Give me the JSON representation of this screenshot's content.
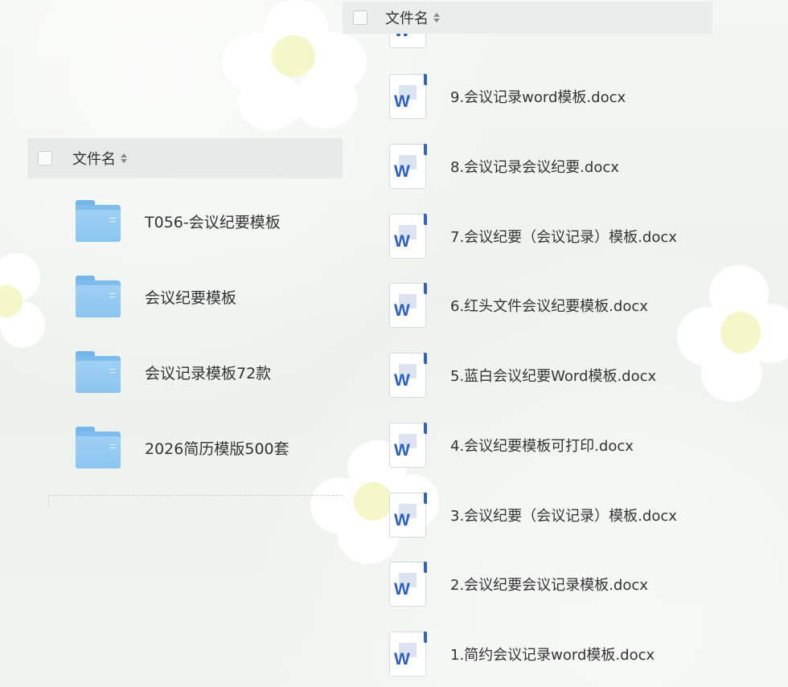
{
  "left_panel": {
    "header_label": "文件名",
    "folders": [
      {
        "name": "T056-会议纪要模板"
      },
      {
        "name": "会议纪要模板"
      },
      {
        "name": "会议记录模板72款"
      },
      {
        "name": "2026简历模版500套"
      }
    ]
  },
  "right_panel": {
    "header_label": "文件名",
    "icon_letter": "W",
    "files": [
      {
        "name": "9.会议记录word模板.docx"
      },
      {
        "name": "8.会议记录会议纪要.docx"
      },
      {
        "name": "7.会议纪要（会议记录）模板.docx"
      },
      {
        "name": "6.红头文件会议纪要模板.docx"
      },
      {
        "name": "5.蓝白会议纪要Word模板.docx"
      },
      {
        "name": "4.会议纪要模板可打印.docx"
      },
      {
        "name": "3.会议纪要（会议记录）模板.docx"
      },
      {
        "name": "2.会议纪要会议记录模板.docx"
      },
      {
        "name": "1.简约会议记录word模板.docx"
      }
    ]
  },
  "colors": {
    "folder_blue": "#8bc5f0",
    "word_blue": "#2b5fc2",
    "header_bg": "#e4e8e6",
    "text": "#333333"
  }
}
